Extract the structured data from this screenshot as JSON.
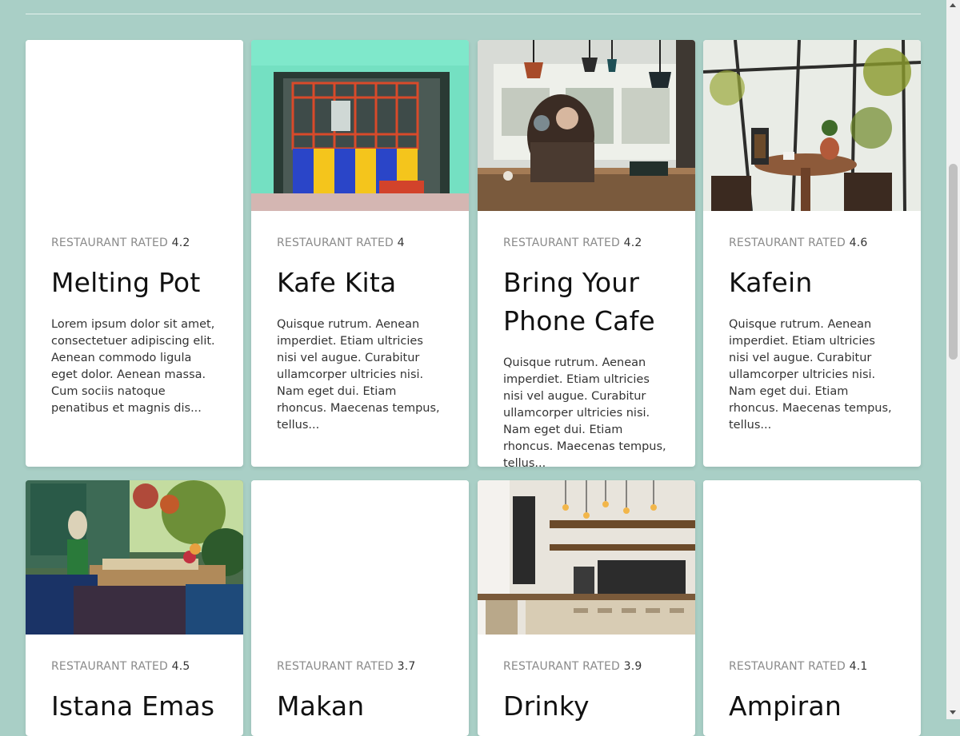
{
  "rating_prefix": "RESTAURANT RATED",
  "restaurants": [
    {
      "rating": "4.2",
      "name": "Melting Pot",
      "description": "Lorem ipsum dolor sit amet, consectetuer adipiscing elit. Aenean commodo ligula eget dolor. Aenean massa. Cum sociis natoque penatibus et magnis dis..."
    },
    {
      "rating": "4",
      "name": "Kafe Kita",
      "description": "Quisque rutrum. Aenean imperdiet. Etiam ultricies nisi vel augue. Curabitur ullamcorper ultricies nisi. Nam eget dui. Etiam rhoncus. Maecenas tempus, tellus..."
    },
    {
      "rating": "4.2",
      "name": "Bring Your Phone Cafe",
      "description": "Quisque rutrum. Aenean imperdiet. Etiam ultricies nisi vel augue. Curabitur ullamcorper ultricies nisi. Nam eget dui. Etiam rhoncus. Maecenas tempus, tellus..."
    },
    {
      "rating": "4.6",
      "name": "Kafein",
      "description": "Quisque rutrum. Aenean imperdiet. Etiam ultricies nisi vel augue. Curabitur ullamcorper ultricies nisi. Nam eget dui. Etiam rhoncus. Maecenas tempus, tellus..."
    },
    {
      "rating": "4.5",
      "name": "Istana Emas"
    },
    {
      "rating": "3.7",
      "name": "Makan"
    },
    {
      "rating": "3.9",
      "name": "Drinky"
    },
    {
      "rating": "4.1",
      "name": "Ampiran"
    }
  ]
}
